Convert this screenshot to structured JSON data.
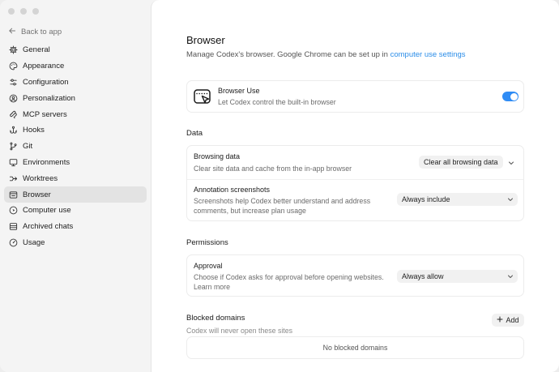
{
  "sidebar": {
    "back_label": "Back to app",
    "items": [
      {
        "label": "General",
        "icon": "gear-icon"
      },
      {
        "label": "Appearance",
        "icon": "palette-icon"
      },
      {
        "label": "Configuration",
        "icon": "sliders-icon"
      },
      {
        "label": "Personalization",
        "icon": "person-icon"
      },
      {
        "label": "MCP servers",
        "icon": "mcp-icon"
      },
      {
        "label": "Hooks",
        "icon": "hook-icon"
      },
      {
        "label": "Git",
        "icon": "git-branch-icon"
      },
      {
        "label": "Environments",
        "icon": "monitor-icon"
      },
      {
        "label": "Worktrees",
        "icon": "tree-icon"
      },
      {
        "label": "Browser",
        "icon": "browser-icon"
      },
      {
        "label": "Computer use",
        "icon": "cursor-icon"
      },
      {
        "label": "Archived chats",
        "icon": "archive-icon"
      },
      {
        "label": "Usage",
        "icon": "gauge-icon"
      }
    ],
    "active_index": 9
  },
  "main": {
    "title": "Browser",
    "subtitle_prefix": "Manage Codex's browser. Google Chrome can be set up in ",
    "subtitle_link": "computer use settings",
    "browser_use": {
      "title": "Browser Use",
      "description": "Let Codex control the built-in browser",
      "enabled": true
    },
    "data_section": {
      "label": "Data",
      "browsing_data": {
        "title": "Browsing data",
        "description": "Clear site data and cache from the in-app browser",
        "button": "Clear all browsing data"
      },
      "annotation_screenshots": {
        "title": "Annotation screenshots",
        "description_line1": "Screenshots help Codex better understand and address",
        "description_line2": "comments, but increase plan usage",
        "selected": "Always include"
      }
    },
    "permissions_section": {
      "label": "Permissions",
      "approval": {
        "title": "Approval",
        "description": "Choose if Codex asks for approval before opening websites.",
        "learn_more": "Learn more",
        "selected": "Always allow"
      }
    },
    "blocked_domains": {
      "label": "Blocked domains",
      "description": "Codex will never open these sites",
      "add_button": "Add",
      "empty_text": "No blocked domains"
    }
  },
  "colors": {
    "accent": "#2f8cf5",
    "link": "#2b8de8",
    "sidebar_bg": "#f4f4f4",
    "active_item_bg": "#e3e3e3"
  }
}
